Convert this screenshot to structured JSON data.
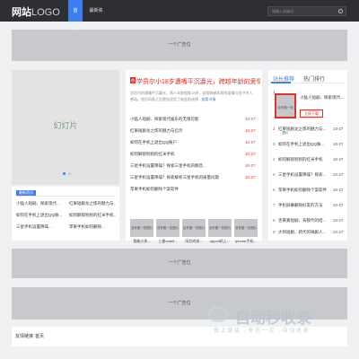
{
  "header": {
    "logo_bold": "网站",
    "logo_light": "LOGO",
    "nav": [
      "首页",
      "最新资讯"
    ],
    "search_placeholder": "请输入关键词"
  },
  "ads": {
    "label": "一个广告位"
  },
  "slider": {
    "label": "幻灯片"
  },
  "latest": {
    "badge": "最新资讯",
    "items": [
      "小猛人短剧、探索现代...",
      "红果短剧龙之炼的魅力与...",
      "如何在手机上退出QQ账...",
      "如何解锁别别的红米手机...",
      "三星手机设置降噪...",
      "苹果手机如何删除..."
    ]
  },
  "featured": {
    "hot_tag": "热",
    "headline": "学员尔小18岁遭嘴平沉瀛光，跨越年龄的爱情与坚守",
    "summary": "学员尔的遭嘴平沉瀛光，两人年龄相差18岁，这段跨越年龄的爱情与坚守令人感动。经历风雨之后更加坚定了彼此的选择...",
    "more": "查看详情"
  },
  "center_list": [
    {
      "title": "小猛人短剧、探索现代娱乐的无限可能",
      "date": "10-27"
    },
    {
      "title": "红果短剧龙之炼的魅力与启示",
      "date": "10-27"
    },
    {
      "title": "如何在手机上退出QQ账户",
      "date": "10-27"
    },
    {
      "title": "如何解锁别别的红米手机",
      "date": "10-27"
    },
    {
      "title": "三星手机设置降噪？探索三星手机的静音...",
      "date": "10-27"
    },
    {
      "title": "三星手机设置降噪？探索解析三星手机的质量问题",
      "date": "10-27"
    },
    {
      "title": "苹果手机如何删除个案软件",
      "date": "10-27"
    }
  ],
  "thumbs": [
    {
      "img": "没有图一张图片",
      "caption": "智能小多..."
    },
    {
      "img": "没有图一张图片",
      "caption": "三星note5..."
    },
    {
      "img": "没有图一张图片",
      "caption": "阿芯的技..."
    },
    {
      "img": "没有图一张图片",
      "caption": "oppo5机上..."
    },
    {
      "img": "没有图一张图片",
      "caption": "iphone手机..."
    }
  ],
  "sidebar": {
    "tabs": [
      "站长推荐",
      "热门排行"
    ],
    "featured_title": "小猛人短剧、探索现代...",
    "featured_img": "没有图一张图片",
    "download": "立即下载",
    "items": [
      {
        "num": "2",
        "title": "红果短剧龙之炼的魅力与...",
        "date": "10-27"
      },
      {
        "num": "3",
        "title": "如何在手机上退出QQ账...",
        "date": "10-27"
      },
      {
        "num": "4",
        "title": "如何解锁别别的红米手机",
        "date": "10-27"
      },
      {
        "num": "5",
        "title": "三星手机设置降噪？探索...",
        "date": "10-27"
      },
      {
        "num": "6",
        "title": "苹果手机如何删除个案软件",
        "date": "10-27"
      },
      {
        "num": "7",
        "title": "手机屏幕删除好友的方法",
        "date": "10-27"
      },
      {
        "num": "8",
        "title": "杏黄素短剧、背肢代的结...",
        "date": "10-27"
      },
      {
        "num": "9",
        "title": "大师短剧、新代的微剧人...",
        "date": "10-27"
      }
    ]
  },
  "footer": {
    "label": "友情链接",
    "links": [
      "首页"
    ]
  },
  "watermark": {
    "text": "自动秒收录",
    "sub": "做 上 链 接 → 来 访 一 次 → 自 动 收 录"
  }
}
